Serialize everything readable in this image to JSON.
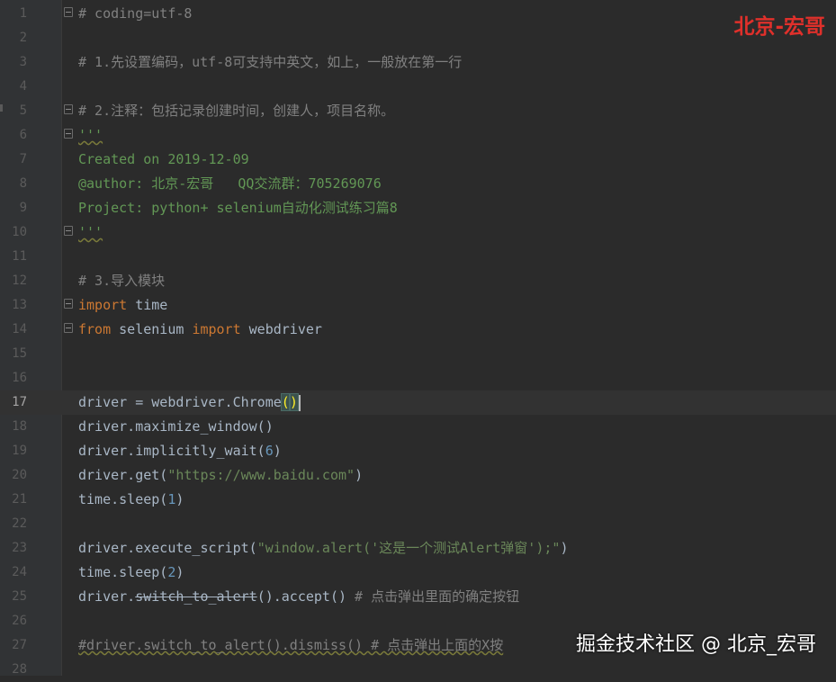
{
  "editor": {
    "lines": [
      {
        "n": "1",
        "tokens": [
          {
            "t": "# coding=utf-8",
            "c": "c-comment"
          }
        ],
        "fold": true
      },
      {
        "n": "2",
        "tokens": []
      },
      {
        "n": "3",
        "tokens": [
          {
            "t": "# 1.先设置编码，utf-8可支持中英文，如上，一般放在第一行",
            "c": "c-comment"
          }
        ]
      },
      {
        "n": "4",
        "tokens": []
      },
      {
        "n": "5",
        "tokens": [
          {
            "t": "# 2.注释：包括记录创建时间，创建人，项目名称。",
            "c": "c-comment"
          }
        ],
        "fold": true
      },
      {
        "n": "6",
        "tokens": [
          {
            "t": "'''",
            "c": "c-doc c-wavy"
          }
        ],
        "fold": true
      },
      {
        "n": "7",
        "tokens": [
          {
            "t": "Created on 2019-12-09",
            "c": "c-doc"
          }
        ]
      },
      {
        "n": "8",
        "tokens": [
          {
            "t": "@author: 北京-宏哥   QQ交流群：705269076",
            "c": "c-doc"
          }
        ]
      },
      {
        "n": "9",
        "tokens": [
          {
            "t": "Project: python+ selenium自动化测试练习篇8",
            "c": "c-doc"
          }
        ]
      },
      {
        "n": "10",
        "tokens": [
          {
            "t": "'''",
            "c": "c-doc c-wavy"
          }
        ],
        "fold": true
      },
      {
        "n": "11",
        "tokens": []
      },
      {
        "n": "12",
        "tokens": [
          {
            "t": "# 3.导入模块",
            "c": "c-comment"
          }
        ]
      },
      {
        "n": "13",
        "tokens": [
          {
            "t": "import",
            "c": "c-kw"
          },
          {
            "t": " time",
            "c": ""
          }
        ],
        "fold": true
      },
      {
        "n": "14",
        "tokens": [
          {
            "t": "from",
            "c": "c-kw"
          },
          {
            "t": " selenium ",
            "c": ""
          },
          {
            "t": "import",
            "c": "c-kw"
          },
          {
            "t": " webdriver",
            "c": ""
          }
        ],
        "fold": true
      },
      {
        "n": "15",
        "tokens": []
      },
      {
        "n": "16",
        "tokens": []
      },
      {
        "n": "17",
        "tokens": [
          {
            "t": "driver = webdriver.Chrome",
            "c": ""
          },
          {
            "t": "(",
            "c": "brace-hl"
          },
          {
            "t": ")",
            "c": "brace-hl"
          }
        ],
        "current": true,
        "caret": true
      },
      {
        "n": "18",
        "tokens": [
          {
            "t": "driver.maximize_window()",
            "c": ""
          }
        ]
      },
      {
        "n": "19",
        "tokens": [
          {
            "t": "driver.implicitly_wait(",
            "c": ""
          },
          {
            "t": "6",
            "c": "c-num"
          },
          {
            "t": ")",
            "c": ""
          }
        ]
      },
      {
        "n": "20",
        "tokens": [
          {
            "t": "driver.get(",
            "c": ""
          },
          {
            "t": "\"https://www.baidu.com\"",
            "c": "c-str"
          },
          {
            "t": ")",
            "c": ""
          }
        ]
      },
      {
        "n": "21",
        "tokens": [
          {
            "t": "time.sleep(",
            "c": ""
          },
          {
            "t": "1",
            "c": "c-num"
          },
          {
            "t": ")",
            "c": ""
          }
        ]
      },
      {
        "n": "22",
        "tokens": []
      },
      {
        "n": "23",
        "tokens": [
          {
            "t": "driver.execute_script(",
            "c": ""
          },
          {
            "t": "\"window.alert('这是一个测试Alert弹窗');\"",
            "c": "c-str"
          },
          {
            "t": ")",
            "c": ""
          }
        ]
      },
      {
        "n": "24",
        "tokens": [
          {
            "t": "time.sleep(",
            "c": ""
          },
          {
            "t": "2",
            "c": "c-num"
          },
          {
            "t": ")",
            "c": ""
          }
        ]
      },
      {
        "n": "25",
        "tokens": [
          {
            "t": "driver.",
            "c": ""
          },
          {
            "t": "switch_to_alert",
            "c": "c-strike"
          },
          {
            "t": "().accept()",
            "c": ""
          },
          {
            "t": " # 点击弹出里面的确定按钮",
            "c": "c-comment"
          }
        ]
      },
      {
        "n": "26",
        "tokens": []
      },
      {
        "n": "27",
        "tokens": [
          {
            "t": "#driver.switch_to_alert().dismiss() # 点击弹出上面的X按",
            "c": "c-comment c-wavy"
          }
        ]
      },
      {
        "n": "28",
        "tokens": []
      }
    ]
  },
  "watermark": {
    "top": "北京-宏哥",
    "bottom": "掘金技术社区 @ 北京_宏哥"
  }
}
